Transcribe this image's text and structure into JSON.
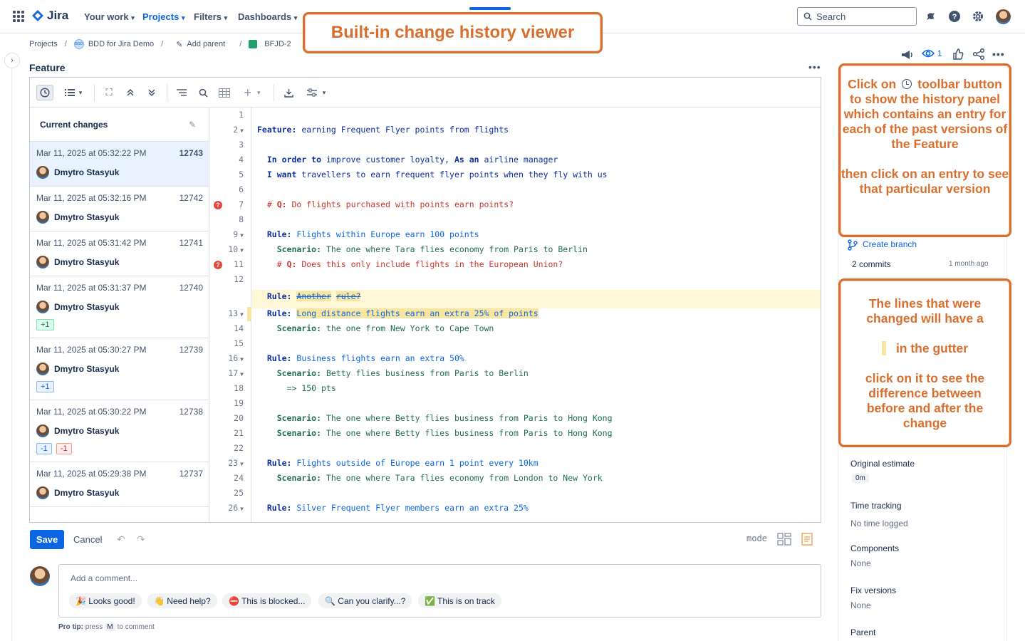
{
  "topnav": {
    "brand": "Jira",
    "items": [
      "Your work",
      "Projects",
      "Filters",
      "Dashboards"
    ],
    "search_placeholder": "Search"
  },
  "breadcrumb": {
    "projects": "Projects",
    "project": "BDD for Jira Demo",
    "add_parent": "Add parent",
    "issue_key": "BFJD-2",
    "project_icon_text": "BDD"
  },
  "editor": {
    "title": "Feature",
    "history_title": "Current changes",
    "history": [
      {
        "date": "Mar 11, 2025 at 05:32:22 PM",
        "version": "12743",
        "user": "Dmytro Stasyuk",
        "badges": []
      },
      {
        "date": "Mar 11, 2025 at 05:32:16 PM",
        "version": "12742",
        "user": "Dmytro Stasyuk",
        "badges": []
      },
      {
        "date": "Mar 11, 2025 at 05:31:42 PM",
        "version": "12741",
        "user": "Dmytro Stasyuk",
        "badges": []
      },
      {
        "date": "Mar 11, 2025 at 05:31:37 PM",
        "version": "12740",
        "user": "Dmytro Stasyuk",
        "badges": [
          {
            "text": "+1",
            "kind": "add"
          }
        ]
      },
      {
        "date": "Mar 11, 2025 at 05:30:27 PM",
        "version": "12739",
        "user": "Dmytro Stasyuk",
        "badges": [
          {
            "text": "+1",
            "kind": "blu"
          }
        ]
      },
      {
        "date": "Mar 11, 2025 at 05:30:22 PM",
        "version": "12738",
        "user": "Dmytro Stasyuk",
        "badges": [
          {
            "text": "-1",
            "kind": "blu"
          },
          {
            "text": "-1",
            "kind": "del"
          }
        ]
      },
      {
        "date": "Mar 11, 2025 at 05:29:38 PM",
        "version": "12737",
        "user": "Dmytro Stasyuk",
        "badges": []
      }
    ],
    "lines": [
      {
        "n": "1",
        "fold": false,
        "kind": "plain",
        "parts": [
          {
            "t": "",
            "c": ""
          }
        ]
      },
      {
        "n": "2",
        "fold": true,
        "kind": "feat",
        "parts": [
          {
            "t": "Feature:",
            "c": "kw"
          },
          {
            "t": " earning Frequent Flyer points from flights",
            "c": ""
          }
        ]
      },
      {
        "n": "3",
        "fold": false,
        "kind": "plain",
        "parts": [
          {
            "t": "",
            "c": ""
          }
        ]
      },
      {
        "n": "4",
        "fold": false,
        "kind": "intro",
        "parts": [
          {
            "t": "  In order to",
            "c": "kw"
          },
          {
            "t": " improve customer loyalty, ",
            "c": ""
          },
          {
            "t": "As an",
            "c": "kw"
          },
          {
            "t": " airline manager",
            "c": ""
          }
        ]
      },
      {
        "n": "5",
        "fold": false,
        "kind": "intro",
        "parts": [
          {
            "t": "  I want",
            "c": "kw"
          },
          {
            "t": " travellers to earn frequent flyer points when they fly with us",
            "c": ""
          }
        ]
      },
      {
        "n": "6",
        "fold": false,
        "kind": "plain",
        "parts": [
          {
            "t": "",
            "c": ""
          }
        ]
      },
      {
        "n": "7",
        "fold": false,
        "kind": "cm",
        "q": true,
        "parts": [
          {
            "t": "  # ",
            "c": ""
          },
          {
            "t": "Q:",
            "c": "kw"
          },
          {
            "t": " Do flights purchased with points earn points?",
            "c": ""
          }
        ]
      },
      {
        "n": "8",
        "fold": false,
        "kind": "plain",
        "parts": [
          {
            "t": "",
            "c": ""
          }
        ]
      },
      {
        "n": "9",
        "fold": true,
        "kind": "rule",
        "parts": [
          {
            "t": "  Rule:",
            "c": "kw"
          },
          {
            "t": " Flights within Europe earn 100 points",
            "c": ""
          }
        ]
      },
      {
        "n": "10",
        "fold": true,
        "kind": "sc",
        "parts": [
          {
            "t": "    Scenario:",
            "c": "kw"
          },
          {
            "t": " The one where Tara flies economy from Paris to Berlin",
            "c": ""
          }
        ]
      },
      {
        "n": "11",
        "fold": false,
        "kind": "cm",
        "q": true,
        "parts": [
          {
            "t": "    # ",
            "c": ""
          },
          {
            "t": "Q:",
            "c": "kw"
          },
          {
            "t": " Does this only include flights in the European Union?",
            "c": ""
          }
        ]
      },
      {
        "n": "12",
        "fold": false,
        "kind": "plain",
        "parts": [
          {
            "t": "",
            "c": ""
          }
        ]
      },
      {
        "n": "",
        "fold": false,
        "kind": "rule",
        "deleted": true,
        "parts": [
          {
            "t": "  Rule:",
            "c": "kw"
          },
          {
            "t": " ",
            "c": ""
          },
          {
            "t": "Another",
            "c": "strike"
          },
          {
            "t": " ",
            "c": ""
          },
          {
            "t": "rule?",
            "c": "strike"
          }
        ]
      },
      {
        "n": "13",
        "fold": true,
        "kind": "rule",
        "changed": true,
        "parts": [
          {
            "t": "  Rule:",
            "c": "kw"
          },
          {
            "t": " ",
            "c": ""
          },
          {
            "t": "Long distance flights earn an extra 25% of points",
            "c": "hl"
          }
        ]
      },
      {
        "n": "14",
        "fold": false,
        "kind": "sc",
        "parts": [
          {
            "t": "    Scenario:",
            "c": "kw"
          },
          {
            "t": " the one from New York to Cape Town",
            "c": ""
          }
        ]
      },
      {
        "n": "15",
        "fold": false,
        "kind": "plain",
        "parts": [
          {
            "t": "",
            "c": ""
          }
        ]
      },
      {
        "n": "16",
        "fold": true,
        "kind": "rule",
        "parts": [
          {
            "t": "  Rule:",
            "c": "kw"
          },
          {
            "t": " Business flights earn an extra 50%",
            "c": ""
          }
        ]
      },
      {
        "n": "17",
        "fold": true,
        "kind": "sc",
        "parts": [
          {
            "t": "    Scenario:",
            "c": "kw"
          },
          {
            "t": " Betty flies business from Paris to Berlin",
            "c": ""
          }
        ]
      },
      {
        "n": "18",
        "fold": false,
        "kind": "sc",
        "parts": [
          {
            "t": "      => 150 pts",
            "c": ""
          }
        ]
      },
      {
        "n": "19",
        "fold": false,
        "kind": "plain",
        "parts": [
          {
            "t": "",
            "c": ""
          }
        ]
      },
      {
        "n": "20",
        "fold": false,
        "kind": "sc",
        "parts": [
          {
            "t": "    Scenario:",
            "c": "kw"
          },
          {
            "t": " The one where Betty flies business from Paris to Hong Kong",
            "c": ""
          }
        ]
      },
      {
        "n": "21",
        "fold": false,
        "kind": "sc",
        "parts": [
          {
            "t": "    Scenario:",
            "c": "kw"
          },
          {
            "t": " The one where Betty flies business from Paris to Hong Kong",
            "c": ""
          }
        ]
      },
      {
        "n": "22",
        "fold": false,
        "kind": "plain",
        "parts": [
          {
            "t": "",
            "c": ""
          }
        ]
      },
      {
        "n": "23",
        "fold": true,
        "kind": "rule",
        "parts": [
          {
            "t": "  Rule:",
            "c": "kw"
          },
          {
            "t": " Flights outside of Europe earn 1 point every 10km",
            "c": ""
          }
        ]
      },
      {
        "n": "24",
        "fold": false,
        "kind": "sc",
        "parts": [
          {
            "t": "    Scenario:",
            "c": "kw"
          },
          {
            "t": " The one where Tara flies economy from London to New York",
            "c": ""
          }
        ]
      },
      {
        "n": "25",
        "fold": false,
        "kind": "plain",
        "parts": [
          {
            "t": "",
            "c": ""
          }
        ]
      },
      {
        "n": "26",
        "fold": true,
        "kind": "rule",
        "parts": [
          {
            "t": "  Rule:",
            "c": "kw"
          },
          {
            "t": " Silver Frequent Flyer members earn an extra 25%",
            "c": ""
          }
        ]
      }
    ],
    "save_label": "Save",
    "cancel_label": "Cancel",
    "mode_label": "mode"
  },
  "comment": {
    "placeholder": "Add a comment...",
    "quick": [
      "🎉 Looks good!",
      "👋 Need help?",
      "⛔ This is blocked...",
      "🔍 Can you clarify...?",
      "✅ This is on track"
    ],
    "protip_label": "Pro tip:",
    "protip_press": "press",
    "protip_key": "M",
    "protip_rest": "to comment"
  },
  "sidebar": {
    "watchers": "1",
    "create_branch": "Create branch",
    "commits": "2 commits",
    "commits_age": "1 month ago",
    "original_estimate_label": "Original estimate",
    "original_estimate_value": "0m",
    "time_tracking_label": "Time tracking",
    "time_tracking_value": "No time logged",
    "components_label": "Components",
    "components_value": "None",
    "fix_versions_label": "Fix versions",
    "fix_versions_value": "None",
    "parent_label": "Parent"
  },
  "callouts": {
    "title": "Built-in change history viewer",
    "history_pre": "Click on",
    "history_post": "toolbar button to show the history panel which contains an entry for each of the past versions of the Feature",
    "history_2": "then click on an entry to see that particular version",
    "gutter_1": "The lines that were changed will have a",
    "gutter_2": "in the gutter",
    "gutter_3": "click on it to see the difference between before and after the change"
  },
  "colors": {
    "accent": "#0c66e4",
    "callout": "#d96f2e",
    "change_marker": "#f8e6a0"
  }
}
